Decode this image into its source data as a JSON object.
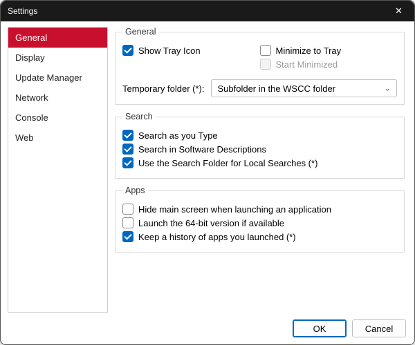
{
  "window": {
    "title": "Settings"
  },
  "sidebar": {
    "items": [
      {
        "label": "General",
        "selected": true
      },
      {
        "label": "Display",
        "selected": false
      },
      {
        "label": "Update Manager",
        "selected": false
      },
      {
        "label": "Network",
        "selected": false
      },
      {
        "label": "Console",
        "selected": false
      },
      {
        "label": "Web",
        "selected": false
      }
    ]
  },
  "groups": {
    "general": {
      "legend": "General",
      "show_tray_icon": {
        "label": "Show Tray Icon",
        "checked": true
      },
      "minimize_to_tray": {
        "label": "Minimize to Tray",
        "checked": false
      },
      "start_minimized": {
        "label": "Start Minimized",
        "checked": false,
        "disabled": true
      },
      "temp_folder_label": "Temporary folder (*):",
      "temp_folder_value": "Subfolder in the WSCC folder"
    },
    "search": {
      "legend": "Search",
      "as_you_type": {
        "label": "Search as you Type",
        "checked": true
      },
      "in_descriptions": {
        "label": "Search in Software Descriptions",
        "checked": true
      },
      "use_search_folder": {
        "label": "Use the Search Folder for Local Searches (*)",
        "checked": true
      }
    },
    "apps": {
      "legend": "Apps",
      "hide_main": {
        "label": "Hide main screen when launching an application",
        "checked": false
      },
      "launch_64": {
        "label": "Launch the 64-bit version if available",
        "checked": false
      },
      "keep_history": {
        "label": "Keep a history of apps you launched (*)",
        "checked": true
      }
    }
  },
  "footer": {
    "ok": "OK",
    "cancel": "Cancel"
  }
}
